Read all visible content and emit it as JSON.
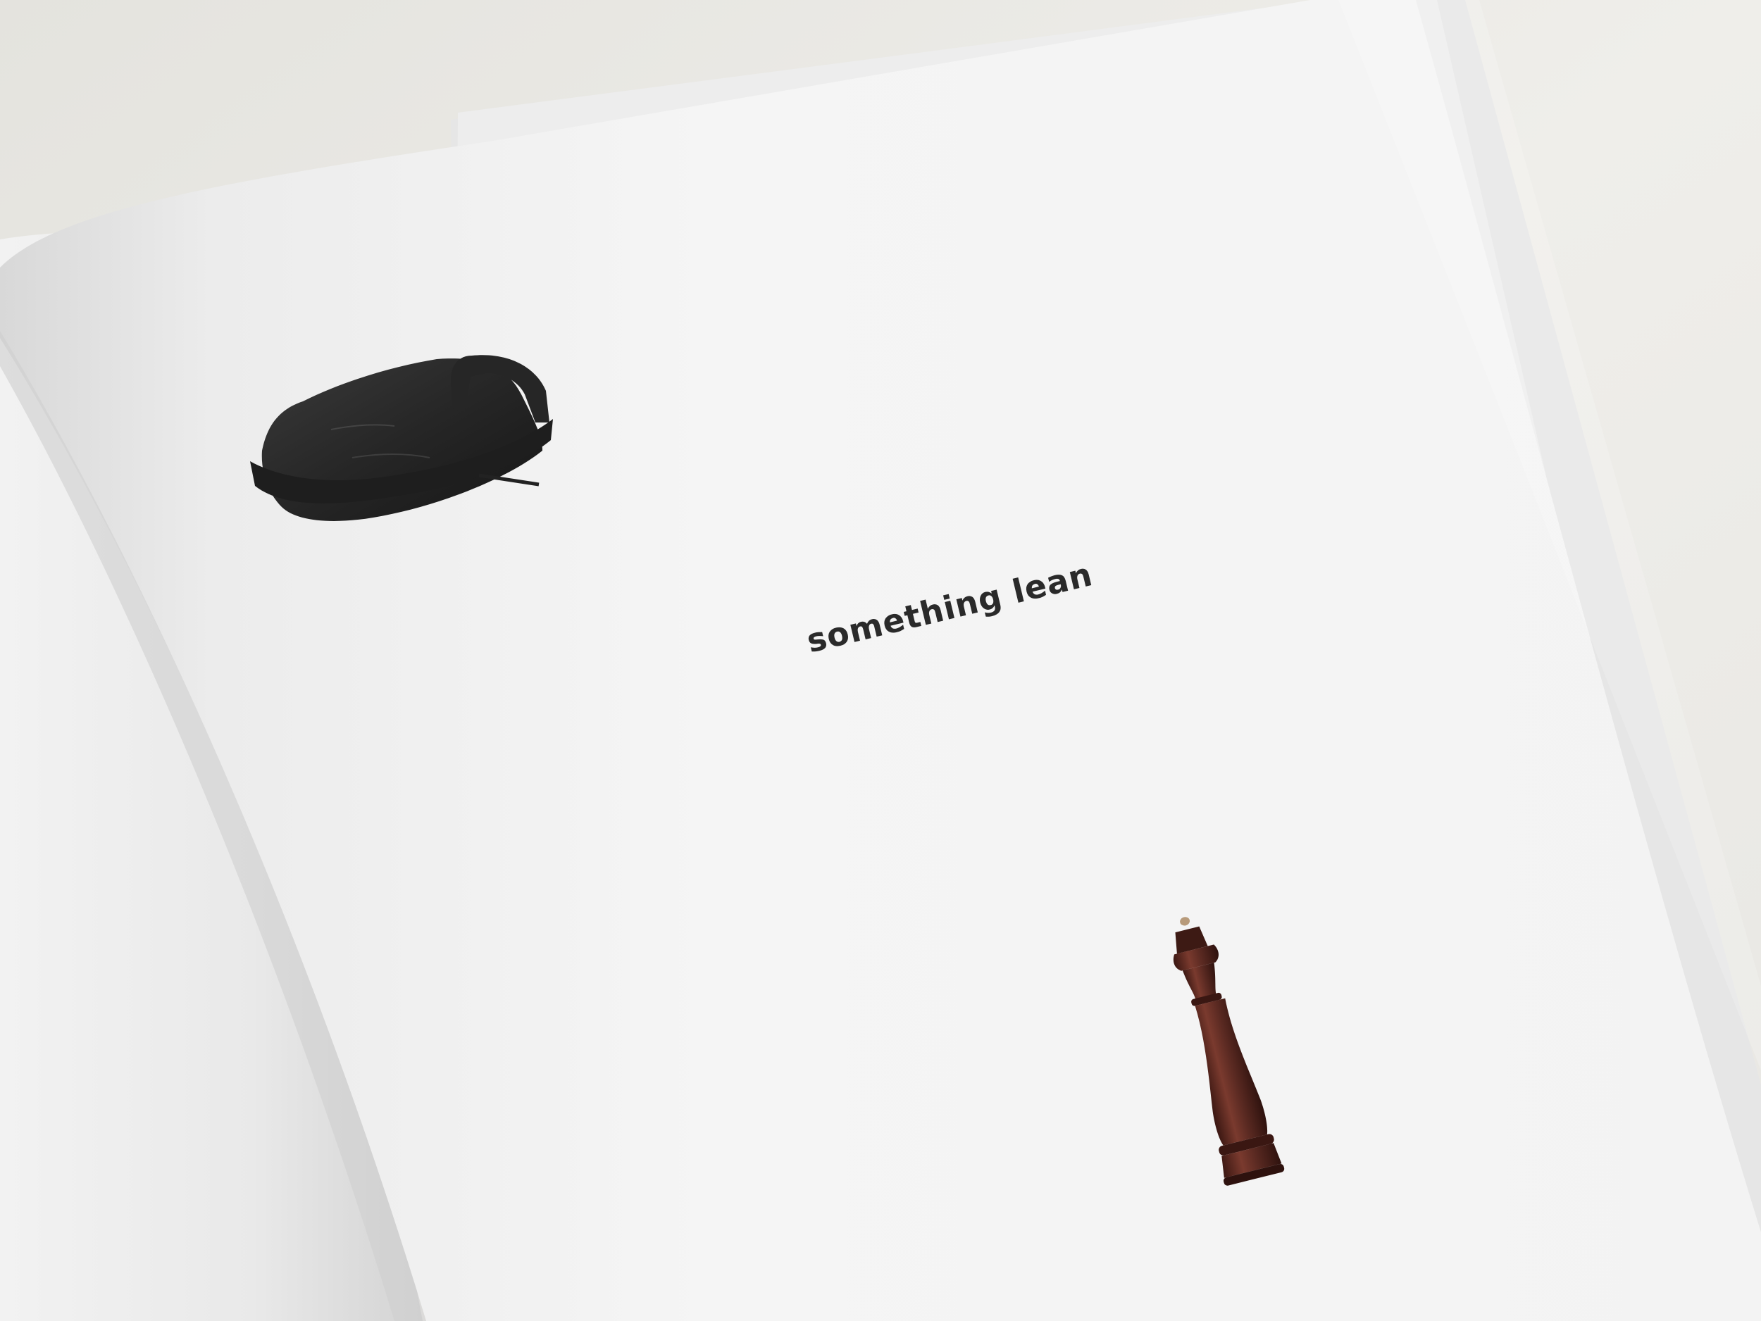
{
  "page": {
    "caption": "something lean"
  },
  "objects": [
    {
      "name": "chair-seat",
      "color": "#2c2c2c"
    },
    {
      "name": "pepper-mill",
      "color": "#5b2a22"
    }
  ],
  "colors": {
    "background": "#eae9e5",
    "paper": "#f6f6f6",
    "ink": "#2a2a2a"
  }
}
